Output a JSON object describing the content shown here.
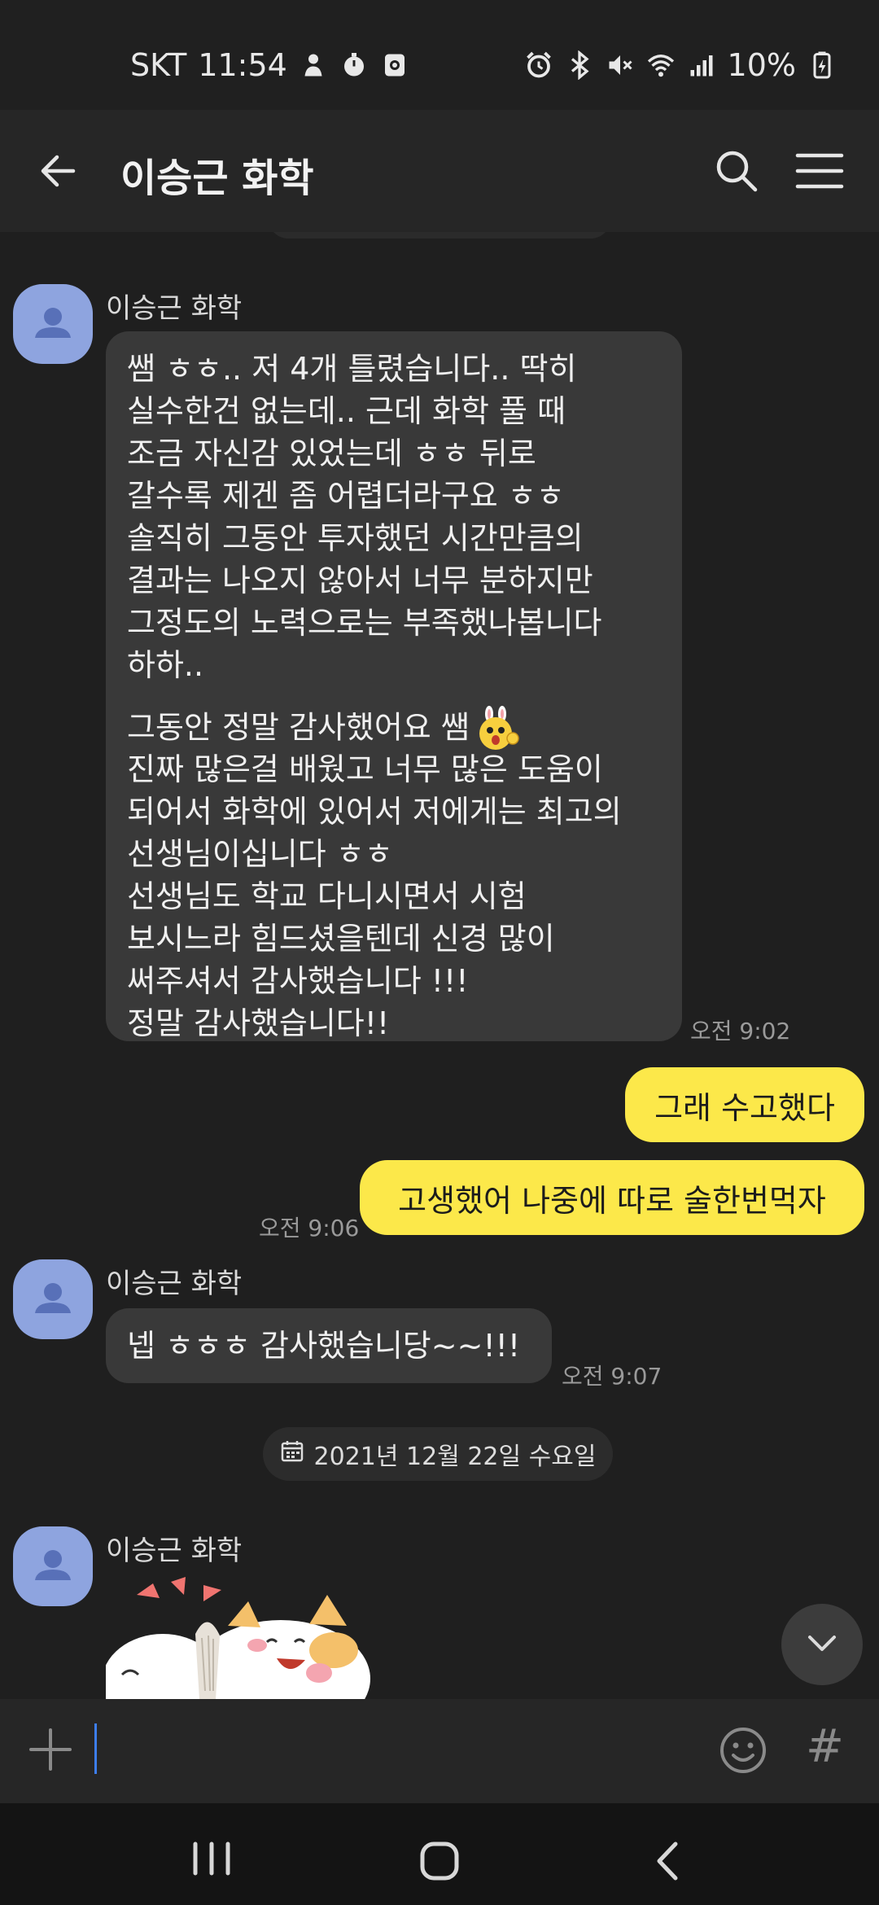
{
  "status_bar": {
    "carrier": "SKT",
    "time": "11:54",
    "battery": "10%",
    "left_icons": [
      "person-icon",
      "timer-icon",
      "camera-icon"
    ],
    "right_icons": [
      "alarm-icon",
      "bluetooth-icon",
      "mute-icon",
      "wifi-icon",
      "signal-icon",
      "battery-charging-icon"
    ]
  },
  "header": {
    "title": "이승근 화학",
    "icons": [
      "back-arrow-icon",
      "search-icon",
      "menu-icon"
    ]
  },
  "messages": [
    {
      "type": "incoming",
      "sender": "이승근 화학",
      "paragraphs": [
        [
          "쌤 ㅎㅎ..  저 4개 틀렸습니다..  딱히",
          "실수한건 없는데.. 근데 화학 풀 때",
          "조금 자신감 있었는데 ㅎㅎ 뒤로",
          "갈수록 제겐 좀 어렵더라구요 ㅎㅎ",
          "솔직히 그동안 투자했던 시간만큼의",
          "결과는 나오지 않아서 너무 분하지만",
          "그정도의 노력으로는 부족했나봅니다",
          "하하.."
        ],
        [
          "그동안 정말 감사했어요 쌤",
          "진짜 많은걸 배웠고 너무 많은 도움이",
          "되어서 화학에 있어서 저에게는 최고의",
          "선생님이십니다 ㅎㅎ",
          "선생님도 학교 다니시면서 시험",
          "보시느라 힘드셨을텐데 신경 많이",
          "써주셔서 감사했습니다 !!!",
          "정말 감사했습니다!!"
        ]
      ],
      "time": "오전 9:02"
    },
    {
      "type": "outgoing",
      "text": "그래 수고했다",
      "time": ""
    },
    {
      "type": "outgoing",
      "text": "고생했어 나중에 따로 술한번먹자",
      "time": "오전 9:06"
    },
    {
      "type": "incoming",
      "sender": "이승근 화학",
      "paragraphs": [
        [
          "넵 ㅎㅎㅎ 감사했습니당~~!!!"
        ]
      ],
      "time": "오전 9:07"
    }
  ],
  "date_divider": {
    "text": "2021년 12월 22일 수요일",
    "icon": "calendar-icon"
  },
  "last_message": {
    "sender": "이승근 화학",
    "sticker": "cat-sticker"
  },
  "input_bar": {
    "value": "",
    "icons": [
      "plus-icon",
      "emoji-icon",
      "hash-icon"
    ],
    "hash_glyph": "#"
  },
  "nav_bar": {
    "icons": [
      "recent-apps-icon",
      "home-icon",
      "back-icon"
    ]
  },
  "colors": {
    "background": "#1f1f1f",
    "incoming_bubble": "#393939",
    "outgoing_bubble": "#fce84a",
    "avatar": "#8ea4df",
    "caret": "#3d7ef0"
  }
}
